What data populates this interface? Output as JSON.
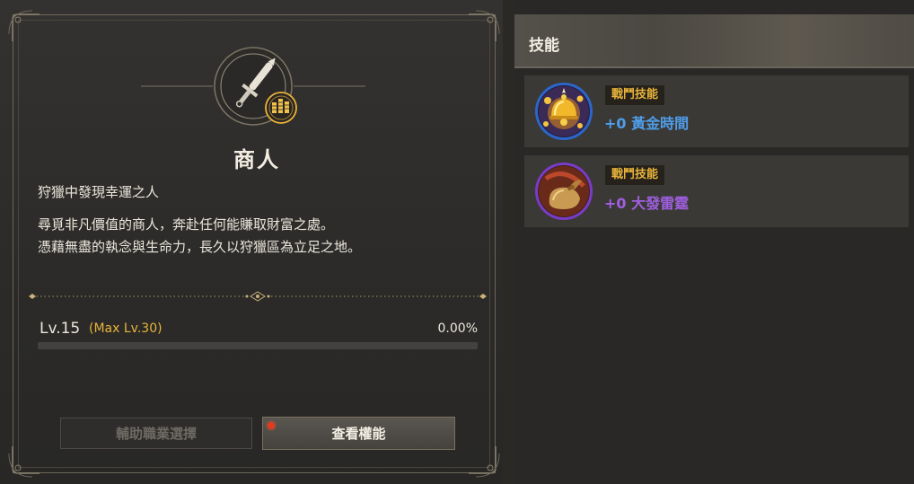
{
  "class_info": {
    "title": "商人",
    "subtitle": "狩獵中發現幸運之人",
    "description": [
      "尋覓非凡價值的商人，奔赴任何能賺取財富之處。",
      "憑藉無盡的執念與生命力，長久以狩獵區為立足之地。"
    ],
    "emblem_icon": "dagger-coin-emblem-icon"
  },
  "level": {
    "label": "Lv.15",
    "max_label": "(Max Lv.30)",
    "percent_label": "0.00%",
    "progress": 0.0
  },
  "buttons": {
    "sub_class_label": "輔助職業選擇",
    "view_skills_label": "查看權能"
  },
  "skills_panel": {
    "title": "技能",
    "items": [
      {
        "tag": "戰鬥技能",
        "name": "+0 黃金時間",
        "name_color": "#4f9de9",
        "icon": "golden-bell-icon"
      },
      {
        "tag": "戰鬥技能",
        "name": "+0 大發雷霆",
        "name_color": "#a05fe0",
        "icon": "money-sack-icon"
      }
    ]
  },
  "colors": {
    "accent_gold": "#e8b43a",
    "notify_red": "#e23a1c"
  }
}
